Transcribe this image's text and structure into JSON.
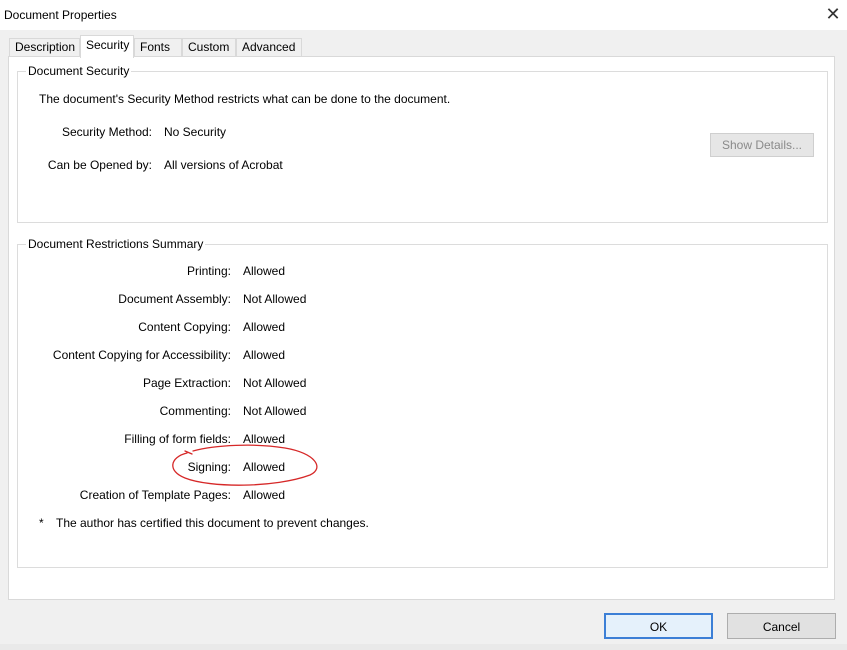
{
  "window": {
    "title": "Document Properties",
    "close_icon": "close-icon"
  },
  "tabs": [
    {
      "label": "Description",
      "active": false
    },
    {
      "label": "Security",
      "active": true
    },
    {
      "label": "Fonts",
      "active": false
    },
    {
      "label": "Custom",
      "active": false
    },
    {
      "label": "Advanced",
      "active": false
    }
  ],
  "security": {
    "group_title": "Document Security",
    "description": "The document's Security Method restricts what can be done to the document.",
    "method_label": "Security Method:",
    "method_value": "No Security",
    "opened_label": "Can be Opened by:",
    "opened_value": "All versions of Acrobat",
    "show_details": "Show Details..."
  },
  "restrictions": {
    "group_title": "Document Restrictions Summary",
    "rows": [
      {
        "label": "Printing:",
        "value": "Allowed"
      },
      {
        "label": "Document Assembly:",
        "value": "Not Allowed"
      },
      {
        "label": "Content Copying:",
        "value": "Allowed"
      },
      {
        "label": "Content Copying for Accessibility:",
        "value": "Allowed"
      },
      {
        "label": "Page Extraction:",
        "value": "Not Allowed"
      },
      {
        "label": "Commenting:",
        "value": "Not Allowed"
      },
      {
        "label": "Filling of form fields:",
        "value": "Allowed"
      },
      {
        "label": "Signing:",
        "value": "Allowed"
      },
      {
        "label": "Creation of Template Pages:",
        "value": "Allowed"
      }
    ],
    "note_marker": "*",
    "note": "The author has certified this document to prevent changes."
  },
  "buttons": {
    "ok": "OK",
    "cancel": "Cancel"
  },
  "colors": {
    "annotation": "#d62828",
    "focus_border": "#3c7fd6"
  }
}
